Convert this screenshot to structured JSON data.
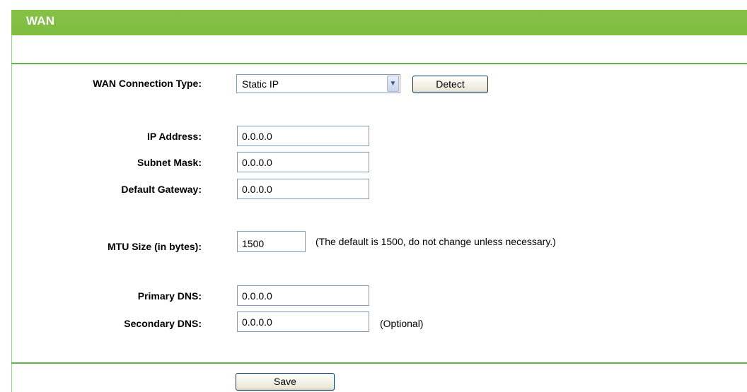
{
  "header": {
    "title": "WAN"
  },
  "connection": {
    "label": "WAN Connection Type:",
    "selected": "Static IP",
    "detect_label": "Detect"
  },
  "ip": {
    "label": "IP Address:",
    "value": "0.0.0.0"
  },
  "subnet": {
    "label": "Subnet Mask:",
    "value": "0.0.0.0"
  },
  "gateway": {
    "label": "Default Gateway:",
    "value": "0.0.0.0"
  },
  "mtu": {
    "label": "MTU Size (in bytes):",
    "value": "1500",
    "hint": "(The default is 1500, do not change unless necessary.)"
  },
  "dns1": {
    "label": "Primary DNS:",
    "value": "0.0.0.0"
  },
  "dns2": {
    "label": "Secondary DNS:",
    "value": "0.0.0.0",
    "hint": "(Optional)"
  },
  "save_label": "Save",
  "colors": {
    "header": "#7ebd3f",
    "rule": "#66b04f"
  }
}
